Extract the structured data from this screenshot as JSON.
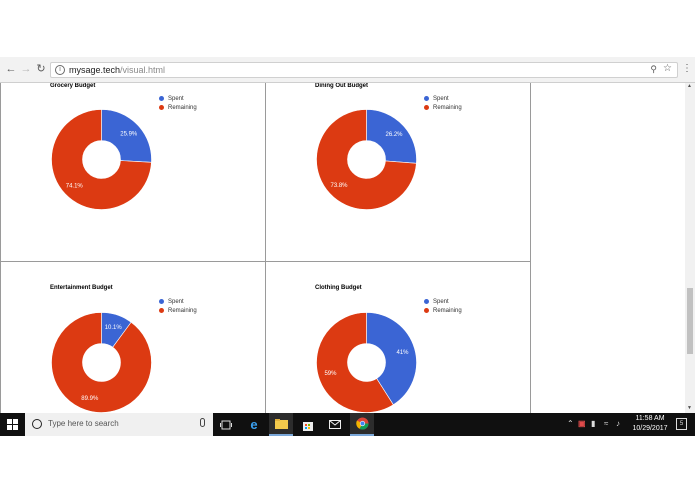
{
  "browser": {
    "url_host": "mysage.tech",
    "url_path": "/visual.html",
    "back_icon": "back-arrow-icon",
    "forward_icon": "forward-arrow-icon",
    "reload_icon": "reload-icon",
    "info_icon": "info-icon",
    "zoom_icon": "zoom-icon",
    "star_icon": "star-icon",
    "menu_icon": "kebab-menu-icon"
  },
  "colors": {
    "spent": "#3b65d4",
    "remaining": "#dc3a12"
  },
  "legend": {
    "spent": "Spent",
    "remaining": "Remaining"
  },
  "chart_data": [
    {
      "type": "pie",
      "title": "Grocery Budget",
      "categories": [
        "Spent",
        "Remaining"
      ],
      "values": [
        25.9,
        74.1
      ],
      "labels": [
        "25.9%",
        "74.1%"
      ],
      "donut": true,
      "legend": "right"
    },
    {
      "type": "pie",
      "title": "Dining Out Budget",
      "categories": [
        "Spent",
        "Remaining"
      ],
      "values": [
        26.2,
        73.8
      ],
      "labels": [
        "26.2%",
        "73.8%"
      ],
      "donut": true,
      "legend": "right"
    },
    {
      "type": "pie",
      "title": "Entertainment Budget",
      "categories": [
        "Spent",
        "Remaining"
      ],
      "values": [
        10.1,
        89.9
      ],
      "labels": [
        "10.1%",
        "89.9%"
      ],
      "donut": true,
      "legend": "right"
    },
    {
      "type": "pie",
      "title": "Clothing Budget",
      "categories": [
        "Spent",
        "Remaining"
      ],
      "values": [
        41,
        59
      ],
      "labels": [
        "41%",
        "59%"
      ],
      "donut": true,
      "legend": "right"
    }
  ],
  "taskbar": {
    "search_placeholder": "Type here to search",
    "time": "11:58 AM",
    "date": "10/29/2017",
    "notification_count": "5"
  }
}
